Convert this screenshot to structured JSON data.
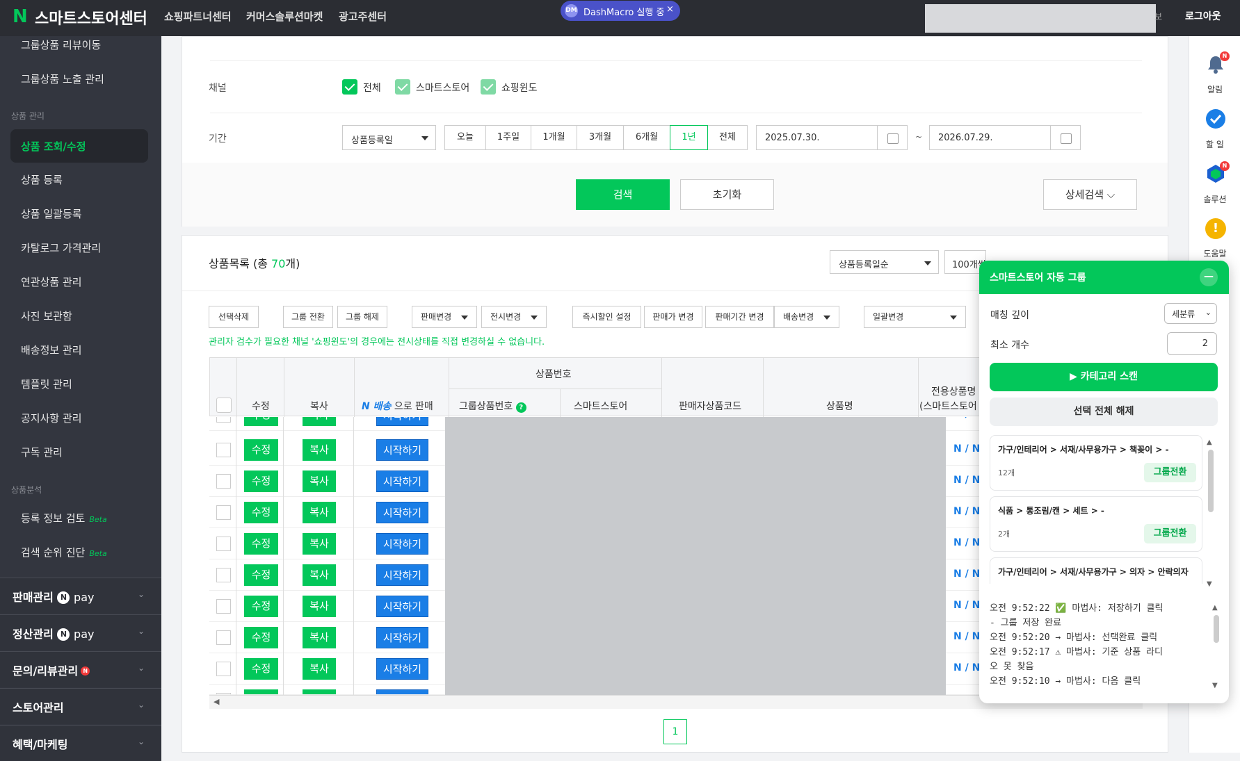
{
  "topbar": {
    "logo_mark": "N",
    "title": "스마트스토어센터",
    "nav": [
      "쇼핑파트너센터",
      "커머스솔루션마켓",
      "광고주센터"
    ],
    "macro_badge": "DM",
    "macro_text": "DashMacro 실행 중",
    "macro_close": "×",
    "partial_text": "보",
    "logout": "로그아웃"
  },
  "sidebar": {
    "items_top": [
      "그룹상품 리뷰이동",
      "그룹상품 노출 관리"
    ],
    "section_product": "상품 관리",
    "active_item": "상품 조회/수정",
    "items": [
      "상품 등록",
      "상품 일괄등록",
      "카탈로그 가격관리",
      "연관상품 관리",
      "사진 보관함",
      "배송정보 관리",
      "템플릿 관리",
      "공지사항 관리",
      "구독 관리"
    ],
    "section_analysis": "상품분석",
    "analysis_items": [
      "등록 정보 검토",
      "검색 순위 진단"
    ],
    "beta": "Beta",
    "groups": [
      "판매관리",
      "정산관리",
      "문의/리뷰관리",
      "스토어관리",
      "혜택/마케팅"
    ],
    "pay_mark": "N",
    "pay_text": "pay",
    "new_badge": "N",
    "chevron": "⌄"
  },
  "filters": {
    "channel_label": "채널",
    "channels": [
      "전체",
      "스마트스토어",
      "쇼핑윈도"
    ],
    "period_label": "기간",
    "period_select": "상품등록일",
    "periods": [
      "오늘",
      "1주일",
      "1개월",
      "3개월",
      "6개월",
      "1년",
      "전체"
    ],
    "period_active": "1년",
    "date_from": "2025.07.30.",
    "date_sep": "~",
    "date_to": "2026.07.29.",
    "search_btn": "검색",
    "reset_btn": "초기화",
    "detail_btn": "상세검색 ⌵"
  },
  "list": {
    "title_prefix": "상품목록 (총 ",
    "count": "70",
    "title_suffix": "개)",
    "sort_select": "상품등록일순",
    "size_select": "100개씩",
    "actions": [
      "선택삭제",
      "그룹 전환",
      "그룹 해제",
      "판매변경",
      "전시변경",
      "즉시할인 설정",
      "판매가 변경",
      "판매기간 변경",
      "배송변경",
      "일괄변경"
    ],
    "warning": "관리자 검수가 필요한 채널 '쇼핑윈도'의 경우에는 전시상태를 직접 변경하실 수 없습니다.",
    "columns": {
      "edit": "수정",
      "copy": "복사",
      "delivery_badge": "N 배송",
      "delivery_suffix": "으로 판매",
      "product_no": "상품번호",
      "group_no": "그룹상품번호",
      "group_help": "?",
      "smartstore": "스마트스토어",
      "seller_code": "판매자상품코드",
      "name": "상품명",
      "exclusive_1": "전용상품명",
      "exclusive_2": "(스마트스토어"
    },
    "row_edit": "수정",
    "row_copy": "복사",
    "row_start": "시작하기",
    "row_nn": "N / N",
    "page": "1"
  },
  "rail": {
    "items": [
      "알림",
      "할 일",
      "솔루션",
      "도움말"
    ],
    "badge": "N",
    "help_glyph": "!"
  },
  "panel": {
    "title": "스마트스토어 자동 그룹",
    "minimize": "—",
    "depth_label": "매칭 깊이",
    "depth_value": "세분류",
    "min_label": "최소 개수",
    "min_value": "2",
    "scan_btn": "▶ 카테고리 스캔",
    "clear_btn": "선택 전체 해제",
    "group_btn": "그룹전환",
    "categories": [
      {
        "path": "가구/인테리어 > 서재/사무용가구 > 책꽂이 > -",
        "count": "12개"
      },
      {
        "path": "식품 > 통조림/캔 > 세트 > -",
        "count": "2개"
      },
      {
        "path": "가구/인테리어 > 서재/사무용가구 > 의자 > 안락의자",
        "count": "2개"
      }
    ],
    "log": [
      "오전 9:52:22 ✅ 마법사: 저장하기 클릭",
      "- 그룹 저장 완료",
      "오전 9:52:20 → 마법사: 선택완료 클릭",
      "오전 9:52:17 ⚠ 마법사: 기준 상품 라디",
      "오 못 찾음",
      "오전 9:52:10 → 마법사: 다음 클릭"
    ]
  }
}
